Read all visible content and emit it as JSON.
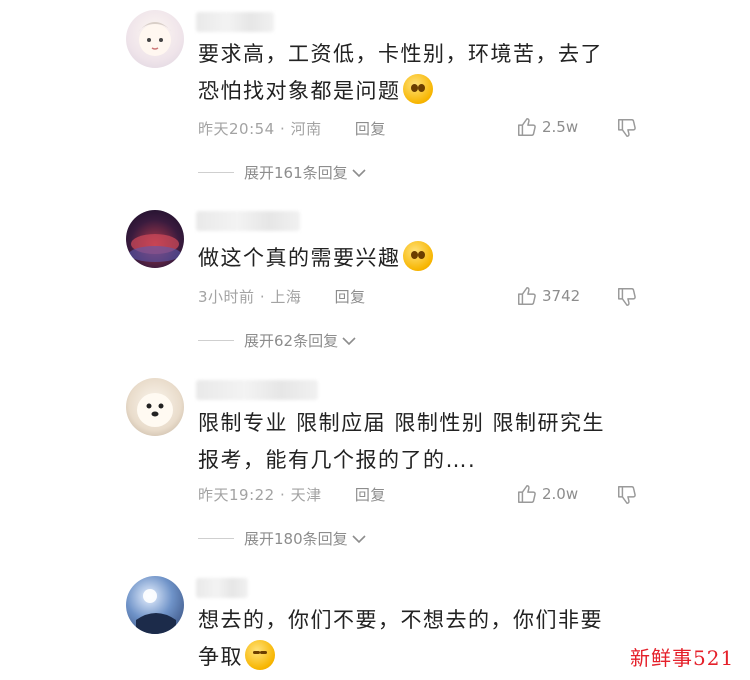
{
  "comments": [
    {
      "text_lines": [
        "要求高，工资低，卡性别，环境苦，去了",
        "恐怕找对象都是问题"
      ],
      "time": "昨天20:54",
      "location": "河南",
      "reply": "回复",
      "likes": "2.5w",
      "expand": "展开161条回复",
      "emoji": "smiling-face-emoji"
    },
    {
      "text_lines": [
        "做这个真的需要兴趣"
      ],
      "time": "3小时前",
      "location": "上海",
      "reply": "回复",
      "likes": "3742",
      "expand": "展开62条回复",
      "emoji": "smiling-face-emoji"
    },
    {
      "text_lines": [
        "限制专业 限制应届 限制性别 限制研究生",
        "报考，能有几个报的了的…."
      ],
      "time": "昨天19:22",
      "location": "天津",
      "reply": "回复",
      "likes": "2.0w",
      "expand": "展开180条回复"
    },
    {
      "text_lines": [
        "想去的，你们不要，不想去的，你们非要",
        "争取"
      ],
      "emoji": "laughing-face-emoji"
    }
  ],
  "watermark": "新鲜事521",
  "colors": {
    "text": "#222222",
    "meta": "#a3a3a3",
    "watermark": "#e5202a"
  }
}
